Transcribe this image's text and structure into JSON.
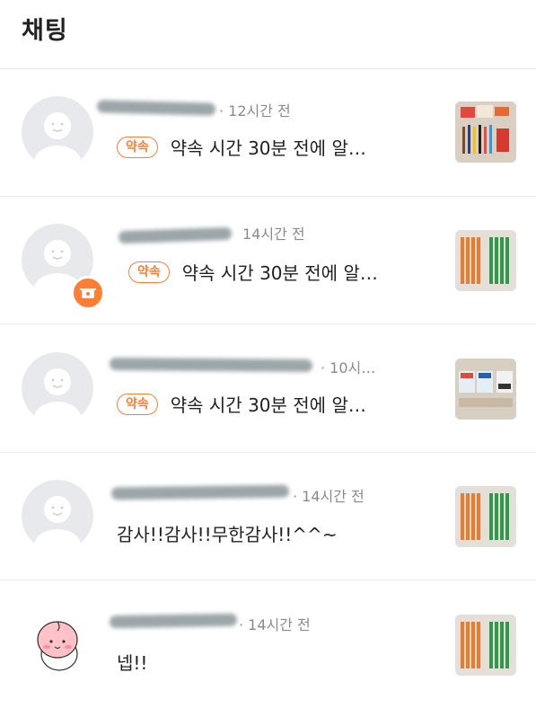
{
  "header": {
    "title": "채팅"
  },
  "chats": [
    {
      "time": "· 12시간 전",
      "tag": "약속",
      "message": "약속 시간 30분 전에 알…",
      "thumb": "thumb-supplies"
    },
    {
      "time": "14시간 전",
      "tag": "약속",
      "message": "약속 시간 30분 전에 알…",
      "thumb": "thumb-pens"
    },
    {
      "time": "· 10시…",
      "tag": "약속",
      "message": "약속 시간 30분 전에 알…",
      "thumb": "thumb-tags"
    },
    {
      "time": "· 14시간 전",
      "message": "감사!!감사!!무한감사!!^^~",
      "thumb": "thumb-pens"
    },
    {
      "time": "· 14시간 전",
      "message": "넵!!",
      "thumb": "thumb-pens"
    }
  ],
  "colors": {
    "accent": "#ff7e36",
    "divider": "#ececec",
    "muted": "#868b94"
  }
}
